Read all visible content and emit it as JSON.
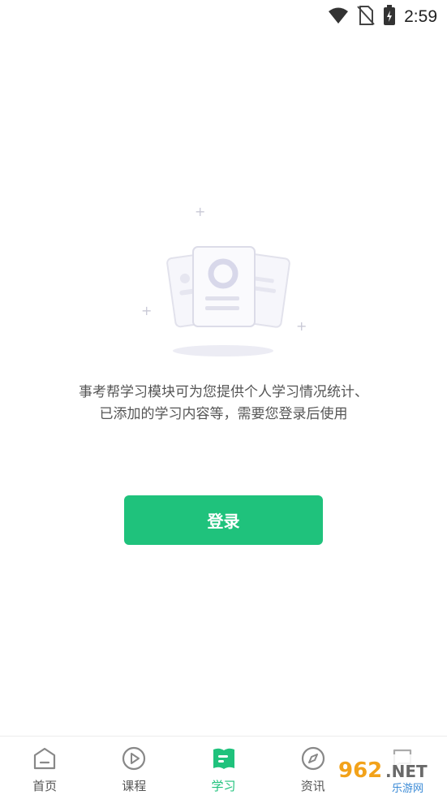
{
  "status": {
    "time": "2:59"
  },
  "empty_state": {
    "message_line1": "事考帮学习模块可为您提供个人学习情况统计、",
    "message_line2": "已添加的学习内容等，需要您登录后使用"
  },
  "login_button": {
    "label": "登录"
  },
  "nav": {
    "items": [
      {
        "label": "首页"
      },
      {
        "label": "课程"
      },
      {
        "label": "学习"
      },
      {
        "label": "资讯"
      },
      {
        "label": ""
      }
    ]
  },
  "watermark": {
    "text": "962.NET",
    "subtext": "乐游网"
  },
  "colors": {
    "accent": "#1fc27c"
  }
}
